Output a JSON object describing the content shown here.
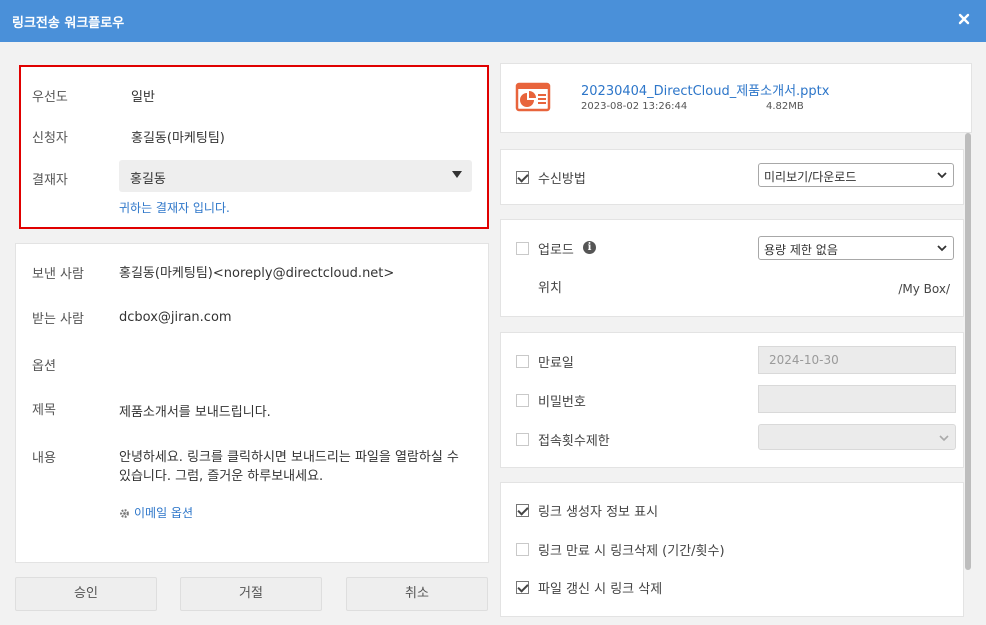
{
  "window": {
    "title": "링크전송 워크플로우"
  },
  "approval": {
    "priority_label": "우선도",
    "priority_value": "일반",
    "applicant_label": "신청자",
    "applicant_value": "홍길동(마케팅팀)",
    "approver_label": "결재자",
    "approver_value": "홍길동",
    "approver_hint": "귀하는 결재자 입니다."
  },
  "message": {
    "sender_label": "보낸 사람",
    "sender_value": "홍길동(마케팅팀)<noreply@directcloud.net>",
    "recipient_label": "받는 사람",
    "recipient_value": "dcbox@jiran.com",
    "options_label": "옵션",
    "subject_label": "제목",
    "subject_value": "제품소개서를 보내드립니다.",
    "body_label": "내용",
    "body_value": "안녕하세요. 링크를 클릭하시면 보내드리는 파일을 열람하실 수 있습니다. 그럼, 즐거운 하루보내세요.",
    "email_options_link": "이메일 옵션"
  },
  "buttons": {
    "approve": "승인",
    "reject": "거절",
    "cancel": "취소"
  },
  "file": {
    "name": "20230404_DirectCloud_제품소개서.pptx",
    "date": "2023-08-02 13:26:44",
    "size": "4.82MB",
    "icon": "pptx-file-icon"
  },
  "receive": {
    "label": "수신방법",
    "checked": true,
    "selected": "미리보기/다운로드"
  },
  "upload": {
    "label": "업로드",
    "checked": false,
    "selected": "용량 제한 없음",
    "location_label": "위치",
    "location_value": "/My Box/"
  },
  "expiry": {
    "label": "만료일",
    "checked": false,
    "value": "2024-10-30"
  },
  "password": {
    "label": "비밀번호",
    "checked": false,
    "value": ""
  },
  "access_limit": {
    "label": "접속횟수제한",
    "checked": false,
    "value": ""
  },
  "extra": {
    "show_creator": {
      "label": "링크 생성자 정보 표시",
      "checked": true
    },
    "delete_on_expire": {
      "label": "링크 만료 시 링크삭제 (기간/횟수)",
      "checked": false
    },
    "delete_on_update": {
      "label": "파일 갱신 시 링크 삭제",
      "checked": true
    }
  },
  "colors": {
    "titlebar": "#4a90d9",
    "link": "#2d76c9",
    "highlight_border": "#e00000",
    "file_icon": "#e8643c"
  }
}
